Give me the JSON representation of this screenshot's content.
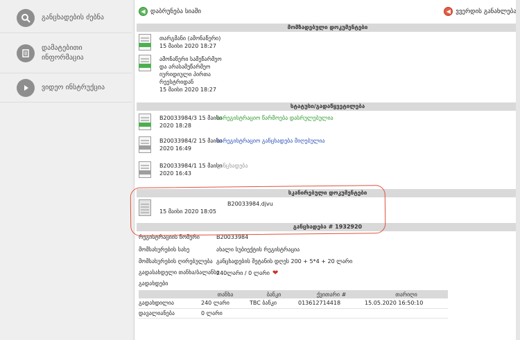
{
  "sidebar": {
    "items": [
      {
        "label": "განცხადების ძებნა",
        "icon": "search-icon"
      },
      {
        "label_line1": "დამატებითი",
        "label_line2": "ინფორმაცია",
        "icon": "document-icon"
      },
      {
        "label": "ვიდეო ინსტრუქცია",
        "icon": "play-icon"
      }
    ]
  },
  "toolbar": {
    "back_label": "დაბრუნება სიაში",
    "full_label": "ვვერდის განახლება"
  },
  "sections": {
    "submitted_docs": "მომზადებული დოკუმენტები",
    "status": "სტატუსი/გადაწყვეტილება",
    "scanned_docs": "სკანირებული დოკუმენტები",
    "application": "განცხადება # 1932920"
  },
  "submitted_docs": [
    {
      "title": "თარგმანი (ამონაწერი)",
      "date": "15 მაისი 2020 18:27"
    },
    {
      "line1": "ამონაწერი სამეწარმეო",
      "line2": "და არასამეწარმეო",
      "line3": "იურიდიული პირთა",
      "line4": "რეესტრიდან",
      "date": "15 მაისი 2020 18:27"
    }
  ],
  "status_rows": [
    {
      "code": "B20033984/3",
      "day": "15 მაისი",
      "time": "2020 18:28",
      "status": "სარეგისტრაციო წარმოება დასრულებულია"
    },
    {
      "code": "B20033984/2",
      "day": "15 მაისი",
      "time": "2020 16:49",
      "status": "სარეგისტრაციო განცხადება მიღებულია"
    },
    {
      "code": "B20033984/1",
      "day": "15 მაისი",
      "time": "2020 16:43",
      "status": "განცხადება"
    }
  ],
  "scanned": {
    "file": "B20033984.djvu",
    "date": "15 მაისი 2020 18:05"
  },
  "info": [
    {
      "label": "რეგისტრაციის ნომერი",
      "value": "B20033984"
    },
    {
      "label": "მომსახურების სახე",
      "value": "ახალი სუბიექტის რეგისტრაცია"
    },
    {
      "label": "მომსახურების ღირებულება",
      "value": "განცხადების შეტანის დღეს 200 + 5*4 + 20 ლარი"
    },
    {
      "label": "გადასახდელი თანხა/ბალანსი",
      "value": "240ლარი / 0 ლარი"
    }
  ],
  "payments_label": "გადახდები",
  "payments": {
    "headers": [
      "",
      "თანხა",
      "ბანკი",
      "ქვითარი #",
      "თარიღი"
    ],
    "rows": [
      [
        "გადახდილია",
        "240 ლარი",
        "TBC ბანკი",
        "013612714418",
        "15.05.2020 16:50:10"
      ],
      [
        "დავალიანება",
        "0 ლარი",
        "",
        "",
        ""
      ]
    ]
  },
  "colors": {
    "annotation": "#e0503a",
    "status_green": "#2e9a2e",
    "status_blue": "#2950b8",
    "header_bg": "#d9d9d9"
  }
}
